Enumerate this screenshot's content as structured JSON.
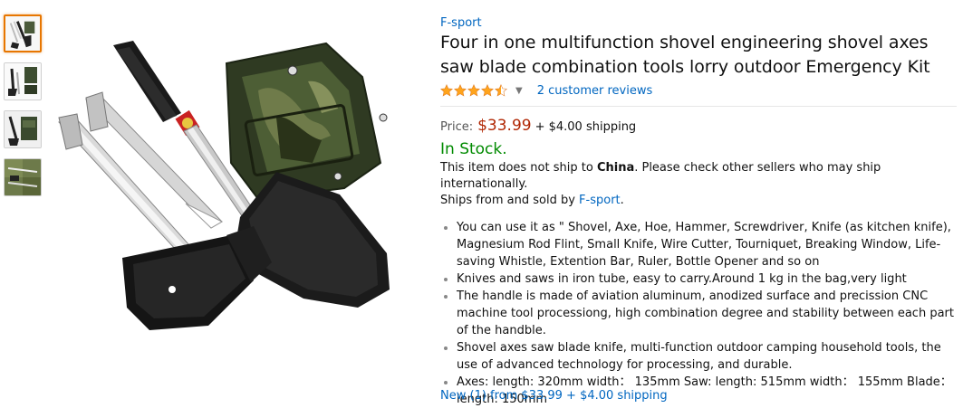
{
  "product": {
    "brand": "F-sport",
    "title": "Four in one multifunction shovel engineering shovel axes saw blade combination tools lorry outdoor Emergency Kit",
    "rating_stars": 4.5,
    "reviews_link": "2 customer reviews",
    "price_label": "Price:",
    "price": "$33.99",
    "shipping": "+ $4.00 shipping",
    "stock": "In Stock.",
    "ship_note_prefix": "This item does not ship to ",
    "ship_note_country": "China",
    "ship_note_suffix": ". Please check other sellers who may ship internationally.",
    "sold_by_prefix": "Ships from and sold by ",
    "sold_by_seller": "F-sport",
    "sold_by_suffix": ".",
    "bullets": [
      "You can use it as \" Shovel, Axe, Hoe, Hammer, Screwdriver, Knife (as kitchen knife), Magnesium Rod Flint, Small Knife, Wire Cutter, Tourniquet, Breaking Window, Life-saving Whistle, Extention Bar, Ruler, Bottle Opener and so on",
      "Knives and saws in iron tube, easy to carry.Around 1 kg in the bag,very light",
      "The handle is made of aviation aluminum, anodized surface and precission CNC machine tool processiong, high combination degree and stability between each part of the handble.",
      "Shovel axes saw blade knife, multi-function outdoor camping household tools, the use of advanced technology for processing, and durable.",
      "Axes: length: 320mm width： 135mm Saw: length: 515mm width： 155mm Blade： length: 150mm"
    ],
    "new_offers_link": "New",
    "new_offers_rest": " (1) from $33.99 + $4.00 shipping"
  },
  "thumbnails": [
    {
      "name": "thumb-1",
      "active": true
    },
    {
      "name": "thumb-2",
      "active": false
    },
    {
      "name": "thumb-3",
      "active": false
    },
    {
      "name": "thumb-4",
      "active": false
    }
  ],
  "colors": {
    "link": "#0066c0",
    "price": "#b12704",
    "stock": "#008a00",
    "star": "#ffa41c",
    "thumb_active_border": "#e77600"
  }
}
